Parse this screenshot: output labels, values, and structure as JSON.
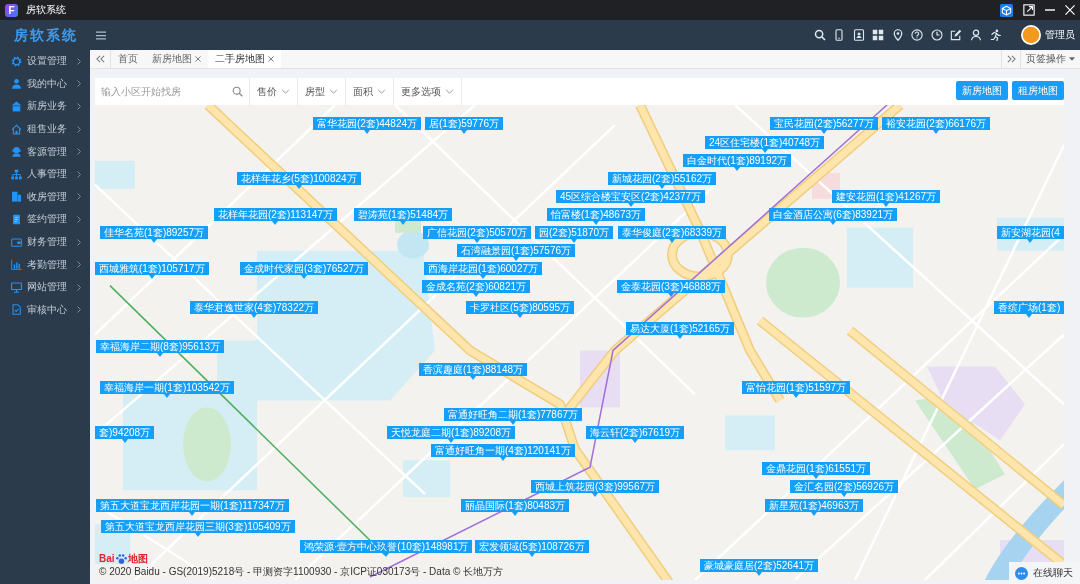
{
  "window": {
    "logo": "F",
    "title": "房软系统"
  },
  "header": {
    "brand": "房软系统",
    "user": "管理员"
  },
  "sidebar": {
    "items": [
      {
        "label": "设置管理",
        "expanded": false
      },
      {
        "label": "我的中心",
        "expanded": false
      },
      {
        "label": "新房业务",
        "expanded": false
      },
      {
        "label": "租售业务",
        "expanded": false
      },
      {
        "label": "客源管理",
        "expanded": false
      },
      {
        "label": "人事管理",
        "expanded": false
      },
      {
        "label": "收房管理",
        "expanded": false
      },
      {
        "label": "签约管理",
        "expanded": false
      },
      {
        "label": "财务管理",
        "expanded": false
      },
      {
        "label": "考勤管理",
        "expanded": false
      },
      {
        "label": "网站管理",
        "expanded": false
      },
      {
        "label": "审核中心",
        "expanded": false
      }
    ]
  },
  "tabs": [
    {
      "label": "首页",
      "selected": false,
      "closable": false
    },
    {
      "label": "新房地图",
      "selected": false,
      "closable": true
    },
    {
      "label": "二手房地图",
      "selected": true,
      "closable": true
    }
  ],
  "tab_actions": "页签操作",
  "filters": {
    "search": {
      "placeholder": "输入小区开始找房"
    },
    "dropdowns": [
      "售价",
      "房型",
      "面积",
      "更多选项"
    ],
    "buttons": [
      "新房地图",
      "租房地图"
    ]
  },
  "map": {
    "labels": [
      "富华花园(2套)44824万",
      "居(1套)59776万",
      "宝民花园(2套)56277万",
      "裕安花园(2套)66176万",
      "24区住宅楼(1套)40748万",
      "白金时代(1套)89192万",
      "花样年花乡(5套)100824万",
      "新城花园(2套)55162万",
      "45区综合楼宝安区(2套)42377万",
      "建安花园(1套)41267万",
      "花样年花园(2套)113147万",
      "碧涛苑(1套)51484万",
      "怡富楼(1套)48673万",
      "白金酒店公寓(6套)83921万",
      "佳华名苑(1套)89257万",
      "广信花园(2套)50570万",
      "园(2套)51870万",
      "泰华俊庭(2套)68339万",
      "新安湖花园(4",
      "石湾融景园(1套)57576万",
      "西城雅筑(1套)105717万",
      "金成时代家园(3套)76527万",
      "西海岸花园(1套)60027万",
      "金成名苑(2套)60821万",
      "金泰花园(3套)46888万",
      "泰华君逸世家(4套)78322万",
      "卡罗社区(5套)80595万",
      "香缤广场(1套)",
      "易达大厦(1套)52165万",
      "幸福海岸二期(8套)95613万",
      "香滨趣庭(1套)88148万",
      "幸福海岸一期(1套)103542万",
      "富怡花园(1套)51597万",
      "富通好旺角二期(1套)77867万",
      "套)94208万",
      "天悦龙庭二期(1套)89208万",
      "海云轩(2套)67619万",
      "富通好旺角一期(4套)120141万",
      "金鼎花园(1套)61551万",
      "西城上筑花园(3套)99567万",
      "金汇名园(2套)56926万",
      "第五大道宝龙西岸花园一期(1套)117347万",
      "丽晶国际(1套)80483万",
      "新星苑(1套)46963万",
      "第五大道宝龙西岸花园三期(3套)105409万",
      "鸿荣源·壹方中心玖誉(10套)148981万",
      "宏发领域(5套)108726万",
      "豪城豪庭居(2套)52641万"
    ],
    "logo": [
      "Bai",
      "地图"
    ],
    "copyright": "© 2020 Baidu - GS(2019)5218号 - 甲测资字1100930 - 京ICP证030173号 - Data © 长地万方"
  },
  "chat": {
    "label": "在线聊天"
  }
}
